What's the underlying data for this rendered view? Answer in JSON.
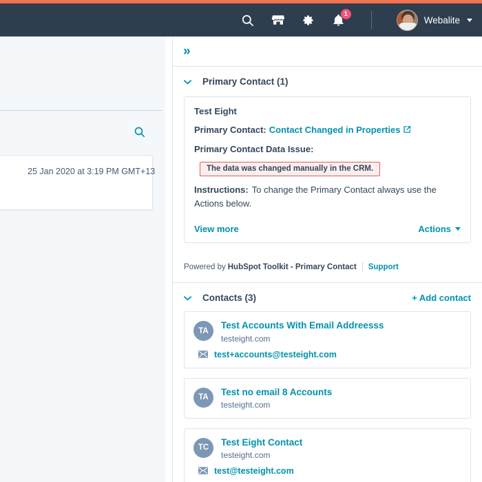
{
  "theme": {
    "accent_orange": "#f2714f",
    "navbar_bg": "#2e3e4e",
    "link_teal": "#0091ae",
    "text_dark": "#33475b",
    "panel_bg": "#f5f8fa",
    "alert_border": "#e05c5c",
    "alert_bg": "#fdeeee",
    "badge_pink": "#f2547d",
    "avatar_bg": "#7c98b6"
  },
  "navbar": {
    "icons": [
      {
        "name": "search-icon",
        "label": "Search"
      },
      {
        "name": "marketplace-icon",
        "label": "Marketplace"
      },
      {
        "name": "settings-gear-icon",
        "label": "Settings"
      },
      {
        "name": "notifications-bell-icon",
        "label": "Notifications"
      }
    ],
    "notification_count": "1",
    "user_name": "Webalite"
  },
  "left_panel": {
    "search_icon": "search-icon",
    "card_timestamp": "25 Jan 2020 at 3:19 PM GMT+13"
  },
  "main_panel": {
    "expand_icon": "chevron-double-right-icon",
    "primary_contact": {
      "title": "Primary Contact (1)",
      "collapse_icon": "chevron-down-icon",
      "card": {
        "name": "Test Eight",
        "primary_contact_label": "Primary Contact:",
        "primary_contact_value": "Contact Changed in Properties",
        "external_link_icon": "external-link-icon",
        "data_issue_label": "Primary Contact Data Issue:",
        "data_issue_alert": "The data was changed manually in the CRM.",
        "instructions_label": "Instructions:",
        "instructions_text": "To change the Primary Contact always use the Actions below.",
        "view_more_label": "View more",
        "actions_label": "Actions",
        "actions_caret_icon": "caret-down-icon"
      }
    },
    "powered_by": {
      "prefix": "Powered by",
      "product": "HubSpot Toolkit - Primary Contact",
      "support_label": "Support"
    },
    "contacts": {
      "title": "Contacts (3)",
      "collapse_icon": "chevron-down-icon",
      "add_contact_label": "+ Add contact",
      "items": [
        {
          "initials": "TA",
          "name": "Test Accounts With Email Addreesss",
          "domain": "testeight.com",
          "email": "test+accounts@testeight.com",
          "email_icon": "envelope-icon"
        },
        {
          "initials": "TA",
          "name": "Test no email 8 Accounts",
          "domain": "testeight.com",
          "email": "",
          "email_icon": "envelope-icon"
        },
        {
          "initials": "TC",
          "name": "Test Eight Contact",
          "domain": "testeight.com",
          "email": "test@testeight.com",
          "email_icon": "envelope-icon"
        }
      ]
    }
  }
}
